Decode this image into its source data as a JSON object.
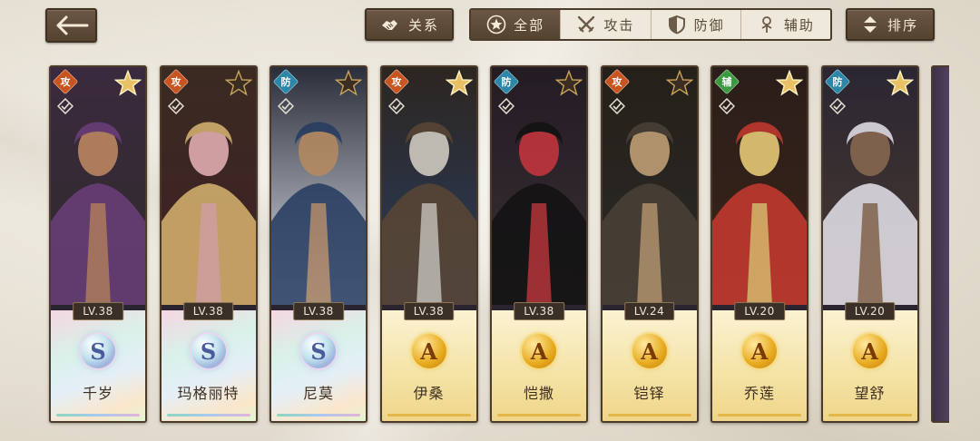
{
  "header": {
    "relation_label": "关系",
    "sort_label": "排序",
    "filters": [
      {
        "label": "全部",
        "icon": "star-badge-icon",
        "active": true
      },
      {
        "label": "攻击",
        "icon": "crossed-swords-icon",
        "active": false
      },
      {
        "label": "防御",
        "icon": "shield-icon",
        "active": false
      },
      {
        "label": "辅助",
        "icon": "support-sigil-icon",
        "active": false
      }
    ]
  },
  "cards": [
    {
      "name": "千岁",
      "level": "LV.38",
      "role": "攻",
      "grade": "S",
      "star": "light"
    },
    {
      "name": "玛格丽特",
      "level": "LV.38",
      "role": "攻",
      "grade": "S",
      "star": "dark"
    },
    {
      "name": "尼莫",
      "level": "LV.38",
      "role": "防",
      "grade": "S",
      "star": "dark"
    },
    {
      "name": "伊桑",
      "level": "LV.38",
      "role": "攻",
      "grade": "A",
      "star": "light"
    },
    {
      "name": "恺撒",
      "level": "LV.38",
      "role": "防",
      "grade": "A",
      "star": "dark"
    },
    {
      "name": "铠铎",
      "level": "LV.24",
      "role": "攻",
      "grade": "A",
      "star": "dark"
    },
    {
      "name": "乔莲",
      "level": "LV.20",
      "role": "辅",
      "grade": "A",
      "star": "light"
    },
    {
      "name": "望舒",
      "level": "LV.20",
      "role": "防",
      "grade": "A",
      "star": "light"
    }
  ],
  "colors": {
    "button_brown": "#5e4b37",
    "attack_role": "#c8541f",
    "defense_role": "#2c86a8",
    "support_role": "#3c9a3e",
    "gold": "#e7a91d"
  }
}
